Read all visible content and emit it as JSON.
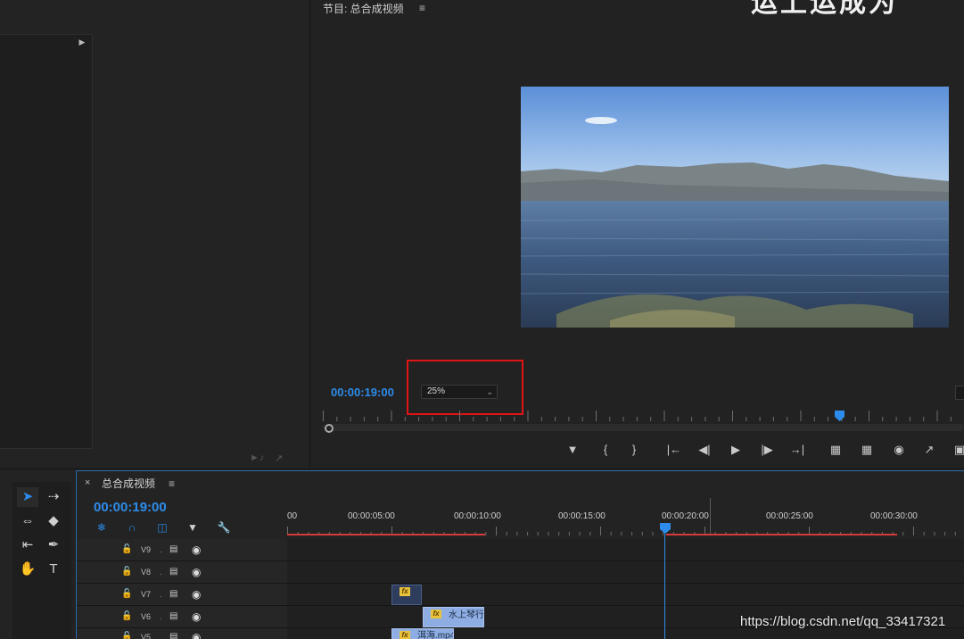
{
  "program_monitor": {
    "title": "节目: 总合成视频",
    "menu_icon": "≡",
    "timecode": "00:00:19:00",
    "zoom": "25%",
    "playhead_fraction": 0.79
  },
  "left_panel": {
    "expand_icon": "triangle-right-icon"
  },
  "overlay": {
    "top_watermark": "运上运成为",
    "url_watermark": "https://blog.csdn.net/qq_33417321"
  },
  "sequence": {
    "close": "×",
    "title": "总合成视频",
    "menu_icon": "≡",
    "timecode": "00:00:19:00"
  },
  "ruler": {
    "labels": [
      "00",
      "00:00:05:00",
      "00:00:10:00",
      "00:00:15:00",
      "00:00:20:00",
      "00:00:25:00",
      "00:00:30:00"
    ]
  },
  "tracks": [
    {
      "name": "V9"
    },
    {
      "name": "V8"
    },
    {
      "name": "V7"
    },
    {
      "name": "V6"
    },
    {
      "name": "V5"
    }
  ],
  "clips": {
    "v6_label": "水上琴行",
    "v5_label": "洱海.mp4"
  },
  "colors": {
    "accent_blue": "#2d8ceb",
    "work_area_red": "#d93b3b",
    "clip_blue": "#8eaee3",
    "highlight_red": "#e01414"
  }
}
